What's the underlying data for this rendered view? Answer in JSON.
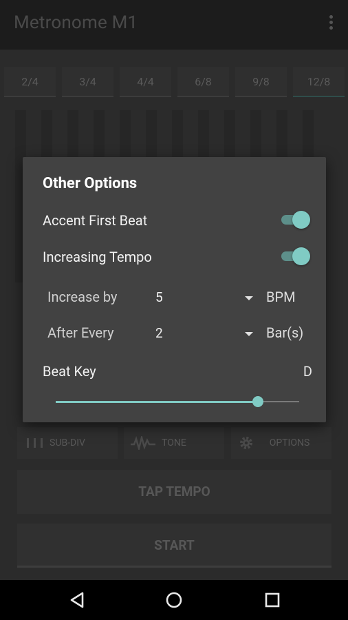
{
  "app": {
    "title": "Metronome M1",
    "time_signatures": [
      "2/4",
      "3/4",
      "4/4",
      "6/8",
      "9/8",
      "12/8"
    ],
    "selected_time_signature": "12/8",
    "tools": [
      {
        "label": "SUB-DIV",
        "icon": "subdivision-icon"
      },
      {
        "label": "TONE",
        "icon": "waveform-icon"
      },
      {
        "label": "OPTIONS",
        "icon": "gear-icon"
      }
    ],
    "tap_tempo_label": "TAP TEMPO",
    "start_label": "START"
  },
  "dialog": {
    "title": "Other Options",
    "accent_first_beat": {
      "label": "Accent First Beat",
      "on": true
    },
    "increasing_tempo": {
      "label": "Increasing Tempo",
      "on": true
    },
    "increase_by": {
      "label": "Increase by",
      "value": "5",
      "unit": "BPM"
    },
    "after_every": {
      "label": "After Every",
      "value": "2",
      "unit": "Bar(s)"
    },
    "beat_key": {
      "label": "Beat Key",
      "value": "D",
      "slider_fraction": 0.83
    },
    "accent_color": "#80cbc4"
  },
  "navbar": {
    "buttons": [
      "back-icon",
      "home-icon",
      "recents-icon"
    ]
  }
}
